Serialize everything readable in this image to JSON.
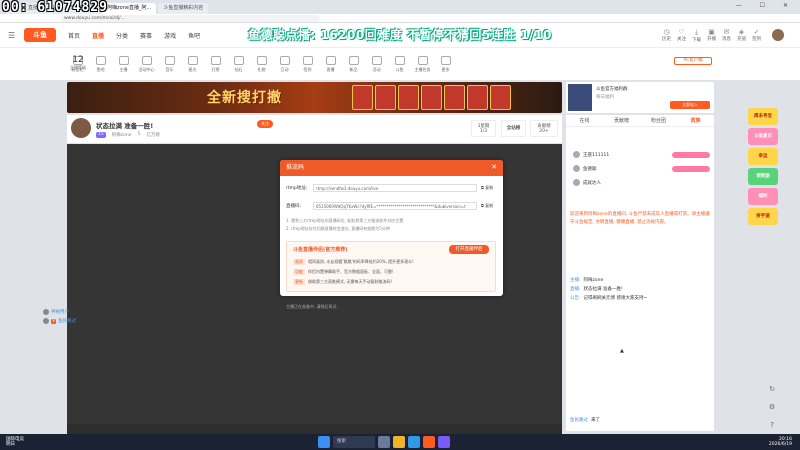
{
  "overlay": {
    "title": "00: 61074829"
  },
  "browser": {
    "tabs": [
      "秀",
      "直播",
      "斗鱼 - 每日精彩赛事",
      "阿梅zone直播_阿...",
      "斗鱼直播精彩内容"
    ],
    "url": "www.douyu.com/mcoi/dj/..."
  },
  "header": {
    "logo": "斗鱼",
    "nav": [
      "首页",
      "直播",
      "分类",
      "赛事",
      "游戏",
      "鱼吧"
    ],
    "banner_text": "鱼德聪点播: 16200回难度 不暂停不猜回5连胜 1/10",
    "icons": [
      "历史",
      "关注",
      "下载",
      "开播",
      "消息",
      "充值",
      "签到"
    ]
  },
  "categories": {
    "level": "12",
    "level_label": "主播等级",
    "items": [
      "粉丝礼",
      "鱼吧",
      "主播",
      "活动中心",
      "音乐",
      "星光",
      "打榜",
      "钻石",
      "礼物",
      "互动",
      "签到",
      "直播",
      "新品",
      "活动",
      "斗鱼",
      "主播任务",
      "更多"
    ],
    "pc_button": "PC客户端"
  },
  "ad": {
    "title": "全新搜打撤",
    "side_title": "斗鱼官方福利群",
    "side_sub": "每日福利",
    "side_button": "立即加入"
  },
  "streamer": {
    "title": "状态拉满 准备一胜!",
    "level_badge": "15",
    "name": "阿梅zone",
    "fans": "5",
    "rank": "亿万榜",
    "follow": "关注",
    "stat1_label": "1星期",
    "stat1_value": "1/3",
    "stat2_label": "全站榜",
    "stat3_label": "贡献榜",
    "stat3_value": "20+"
  },
  "modal": {
    "title": "推流码",
    "rtmp_label": "rtmp地址:",
    "rtmp_value": "rtmp://sendfw3.douyu.com/live",
    "code_label": "直播码:",
    "code_value": "6515069WdQqTKxWc?dyflfE=*****************************&dubiversion=t",
    "copy": "复制",
    "tip1": "1. 需到上方rtmp地址向直播码位, 粘贴到第三方推流软件对应位置",
    "tip2": "2. rtmp地址仅在切换直播时会变化, 直播码有效期为5分钟",
    "promo_title": "斗鱼直播伴侣(官方推荐)",
    "promo_button": "打开直播伴侣",
    "promo_lines": [
      {
        "tag": "画质",
        "text": "相同画质, 水友观看'跳跳'的码率降低约20%, 提升更多观众!"
      },
      {
        "tag": "功能",
        "text": "伴侣内置弹幕助手、官方数据面板、全面、可靠!"
      },
      {
        "tag": "更新",
        "text": "借助第三方直推模式, 无需每天手动复制推流码!"
      }
    ]
  },
  "video": {
    "hint": "主播正在准备中, 请稍后再试."
  },
  "float_chat": [
    {
      "tag": "",
      "name": "神秘用户",
      "text": "来了"
    },
    {
      "tag": "V",
      "name": "鱼民路过",
      "text": "来了"
    }
  ],
  "right_panel": {
    "tabs": [
      "在线",
      "贡献榜",
      "粉丝团",
      "贵族"
    ],
    "ranks": [
      {
        "name": "王座111111"
      },
      {
        "name": "鱼德聪"
      },
      {
        "name": "成就达人"
      }
    ],
    "welcome": "欢迎来到阿梅zone的直播间, 斗鱼严禁未成年人直播或打赏。请主播遵守斗鱼规定, 文明直播, 健康直播, 禁止违规内容。",
    "messages": [
      {
        "who": "主播:",
        "text": "阿梅zone"
      },
      {
        "who": "直播:",
        "text": "状态拉满 准备一胜!"
      },
      {
        "who": "公告:",
        "text": "记得刷刷关元博 感谢大家支持~"
      }
    ],
    "bottom": {
      "who": "鱼民路过",
      "text": "来了"
    }
  },
  "side_promos": [
    "周末寻宝",
    "斗鱼夏日",
    "幸运",
    "领奖励",
    "福利",
    "拼手速"
  ],
  "taskbar": {
    "news_line1": "国际电竞",
    "news_line2": "明日",
    "search": "搜索",
    "time": "20:16",
    "date": "2026/6/19"
  }
}
